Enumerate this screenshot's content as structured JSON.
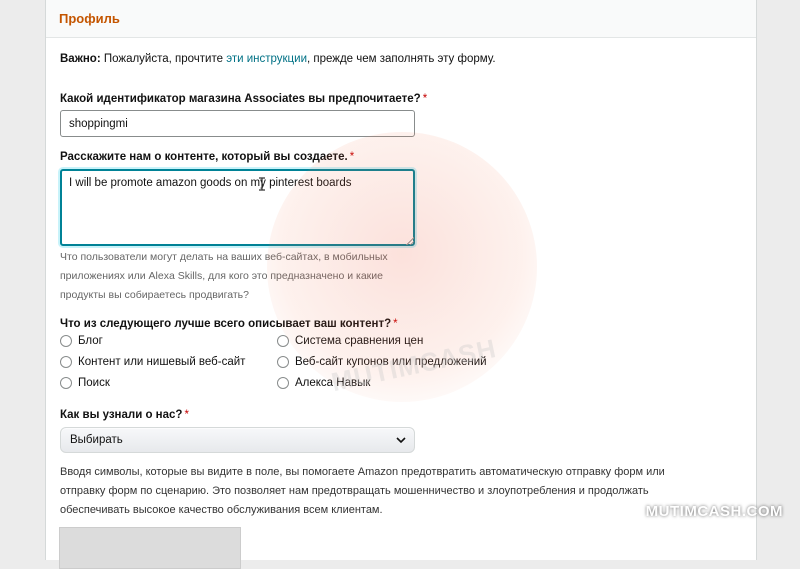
{
  "panel": {
    "title": "Профиль"
  },
  "notice": {
    "bold": "Важно:",
    "before": " Пожалуйста, прочтите ",
    "link": "эти инструкции",
    "after": ", прежде чем заполнять эту форму."
  },
  "store_id": {
    "label": "Какой идентификатор магазина Associates вы предпочитаете?",
    "required": "*",
    "value": "shoppingmi"
  },
  "content_desc": {
    "label": "Расскажите нам о контенте, который вы создаете.",
    "required": "*",
    "value": "I will be promote amazon goods on my pinterest boards",
    "helper": "Что пользователи могут делать на ваших веб-сайтах, в мобильных приложениях или Alexa Skills, для кого это предназначено и какие продукты вы собираетесь продвигать?"
  },
  "content_type": {
    "label": "Что из следующего лучше всего описывает ваш контент?",
    "required": "*",
    "options_left": [
      "Блог",
      "Контент или нишевый веб-сайт",
      "Поиск"
    ],
    "options_right": [
      "Система сравнения цен",
      "Веб-сайт купонов или предложений",
      "Алекса Навык"
    ]
  },
  "referral": {
    "label": "Как вы узнали о нас?",
    "required": "*",
    "selected": "Выбирать"
  },
  "captcha_text": "Вводя символы, которые вы видите в поле, вы помогаете Amazon предотвратить автоматическую отправку форм или отправку форм по сценарию. Это позволяет нам предотвращать мошенничество и злоупотребления и продолжать обеспечивать высокое качество обслуживания всем клиентам.",
  "watermark": {
    "brand": "MUTIMCASH.COM",
    "logo_text": "MUTIMCASH"
  },
  "colors": {
    "accent": "#c45500",
    "link": "#007185",
    "focus": "#008296",
    "required": "#c40000"
  }
}
